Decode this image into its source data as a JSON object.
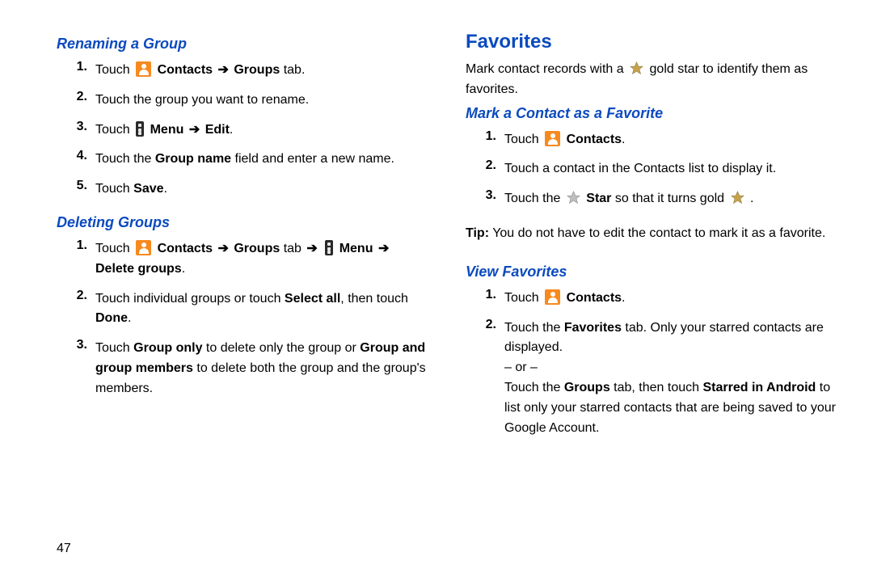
{
  "page_number": "47",
  "left": {
    "sub1_title": "Renaming a Group",
    "sub1_steps_plain": {
      "n1": "1.",
      "n2": "2.",
      "t2": "Touch the group you want to rename.",
      "n3": "3.",
      "n4": "4.",
      "n5": "5."
    },
    "sub2_title": "Deleting Groups",
    "sub2_steps_plain": {
      "n1": "1.",
      "n2": "2.",
      "n3": "3."
    },
    "words": {
      "touch": "Touch ",
      "contacts": " Contacts",
      "arrow": " ➔ ",
      "groups_tab": "Groups",
      "tab_word": " tab.",
      "tab_word_arrow": " tab ",
      "menu": " Menu",
      "edit": "Edit",
      "period": ".",
      "group_name": "Group name",
      "step4_prefix": "Touch the ",
      "step4_suffix": " field and enter a new name.",
      "save": "Save",
      "delete_groups": "Delete groups",
      "del_step2a": "Touch individual groups or touch ",
      "select_all": "Select all",
      "del_step2b": ", then touch ",
      "done": "Done",
      "del_step3a": "Touch ",
      "group_only": "Group only",
      "del_step3b": " to delete only the group or ",
      "group_and_members": "Group and group members",
      "del_step3c": " to delete both the group and the group's members."
    }
  },
  "right": {
    "section_title": "Favorites",
    "intro_a": "Mark contact records with a ",
    "intro_b": " gold star to identify them as favorites.",
    "sub1_title": "Mark a Contact as a Favorite",
    "steps": {
      "n1": "1.",
      "n2": "2.",
      "t2": "Touch a contact in the Contacts list to display it.",
      "n3": "3."
    },
    "words": {
      "touch": "Touch ",
      "contacts": " Contacts",
      "period": ".",
      "touch_the": "Touch the ",
      "star_word": " Star",
      "so_that": " so that it turns gold ",
      "tip_label": "Tip:",
      "tip_text": " You do not have to edit the contact to mark it as a favorite."
    },
    "sub2_title": "View Favorites",
    "vf": {
      "n1": "1.",
      "n2": "2.",
      "touch_the": "Touch the ",
      "fav_tab": "Favorites",
      "vf2a": " tab. Only your starred contacts are displayed.",
      "or": "– or –",
      "groups_tab": "Groups",
      "vf3a": " tab, then touch ",
      "starred": "Starred in Android",
      "vf3b": " to list only your starred contacts that are being saved to your Google Account."
    }
  },
  "chart_data": null
}
